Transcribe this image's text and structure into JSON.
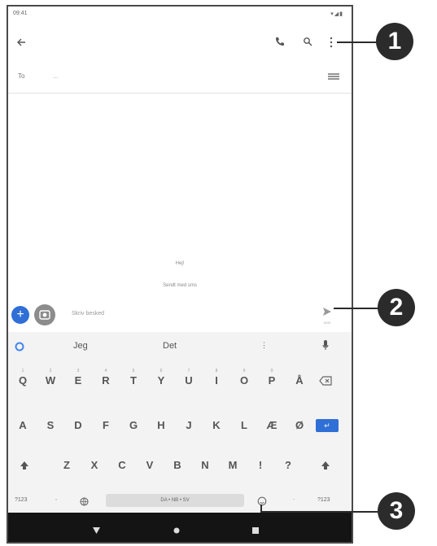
{
  "status_bar": {
    "time": "09:41",
    "right": "▾◢▮"
  },
  "to_row": {
    "label": "To",
    "placeholder": "..."
  },
  "conversation": {
    "line1": "Hej!",
    "line2": "Sendt med sms"
  },
  "compose": {
    "placeholder": "Skriv besked",
    "send_label": "SMS"
  },
  "suggestions": [
    "Jeg",
    "Det"
  ],
  "keyboard": {
    "row1": [
      "Q",
      "W",
      "E",
      "R",
      "T",
      "Y",
      "U",
      "I",
      "O",
      "P",
      "Å"
    ],
    "row1_alt": [
      "1",
      "2",
      "3",
      "4",
      "5",
      "6",
      "7",
      "8",
      "9",
      "0",
      ""
    ],
    "row2": [
      "A",
      "S",
      "D",
      "F",
      "G",
      "H",
      "J",
      "K",
      "L",
      "Æ",
      "Ø"
    ],
    "row3": [
      "Z",
      "X",
      "C",
      "V",
      "B",
      "N",
      "M",
      "!",
      "?"
    ],
    "bottom_left": "?123",
    "comma": ",",
    "space_label": "DA • NB • SV",
    "period": ".",
    "bottom_right": "?123"
  },
  "callouts": [
    "1",
    "2",
    "3"
  ],
  "colors": {
    "accent": "#2f6fd6",
    "nav_bar": "#141414",
    "callout": "#2b2b2b"
  },
  "icons": {
    "back": "arrow-left-icon",
    "phone": "phone-icon",
    "search": "search-icon",
    "more": "more-vert-icon",
    "dialpad": "dialpad-icon",
    "send": "send-icon",
    "emoji": "emoji-icon",
    "mic": "mic-icon",
    "google": "google-icon"
  }
}
